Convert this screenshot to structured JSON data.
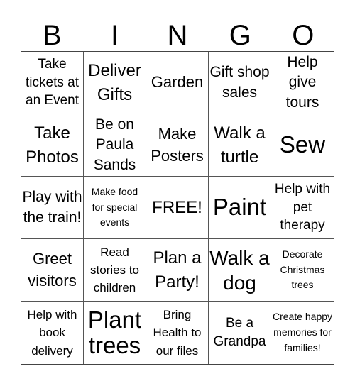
{
  "title_letters": [
    "B",
    "I",
    "N",
    "G",
    "O"
  ],
  "cells": [
    "Take tickets at an Event",
    "Deliver Gifts",
    "Garden",
    "Gift shop sales",
    "Help give tours",
    "Take Photos",
    "Be on Paula Sands",
    "Make Posters",
    "Walk a turtle",
    "Sew",
    "Play with the train!",
    "Make food for special events",
    "FREE!",
    "Paint",
    "Help with pet therapy",
    "Greet visitors",
    "Read stories to children",
    "Plan a Party!",
    "Walk a dog",
    "Decorate Christmas trees",
    "Help with book delivery",
    "Plant trees",
    "Bring Health to our files",
    "Be a Grandpa",
    "Create happy memories for families!"
  ]
}
